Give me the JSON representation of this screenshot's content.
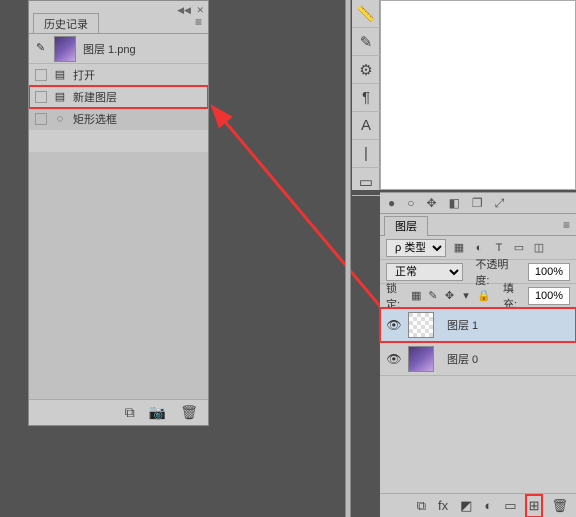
{
  "history": {
    "tab_label": "历史记录",
    "snapshot_label": "图层 1.png",
    "items": [
      {
        "label": "打开",
        "icon": "▤"
      },
      {
        "label": "新建图层",
        "icon": "▤"
      },
      {
        "label": "矩形选框",
        "icon": "◌"
      }
    ],
    "footer": {
      "newdoc": "⧉",
      "camera": "📷",
      "trash": "🗑"
    }
  },
  "toolstrip": {
    "ruler": "📏",
    "brush": "✎",
    "slider": "⚙",
    "para": "¶",
    "type": "A",
    "align": "|",
    "note": "▭"
  },
  "mini": {
    "dot_fill": "●",
    "dot": "○",
    "move": "✥",
    "mask": "◧",
    "overlap": "❐",
    "nav": "⤢"
  },
  "layers": {
    "tab_label": "图层",
    "filter": {
      "label": "ρ 类型",
      "icons": {
        "img": "▦",
        "adj": "◐",
        "type": "T",
        "shape": "▭",
        "smart": "◫"
      }
    },
    "blend": {
      "mode": "正常",
      "opacity_label": "不透明度:",
      "opacity": "100%"
    },
    "lock": {
      "label": "锁定:",
      "fill_label": "填充:",
      "fill": "100%",
      "icons": {
        "pix": "▦",
        "brush": "✎",
        "move": "✥",
        "art": "▾",
        "lock": "🔒"
      }
    },
    "items": [
      {
        "label": "图层 1",
        "selected": true,
        "checker": true
      },
      {
        "label": "图层 0",
        "selected": false,
        "checker": false
      }
    ],
    "footer": {
      "link": "⧉",
      "fx": "fx",
      "mask": "◩",
      "adj": "◐",
      "group": "▭",
      "new": "⊞",
      "trash": "🗑"
    }
  }
}
